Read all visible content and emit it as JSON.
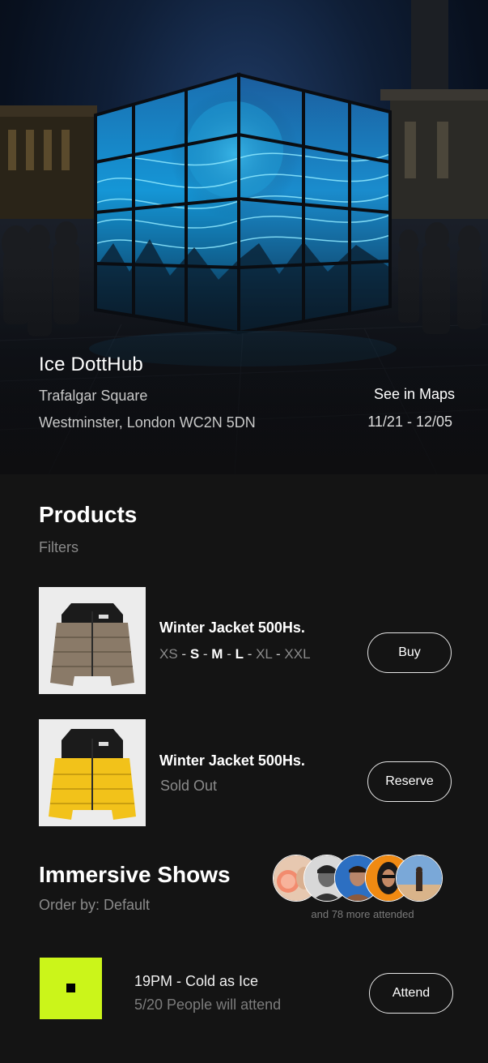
{
  "hero": {
    "title": "Ice DottHub",
    "address_line1": "Trafalgar Square",
    "address_line2": "Westminster, London WC2N 5DN",
    "maps_label": "See in Maps",
    "dates": "11/21 - 12/05"
  },
  "products": {
    "title": "Products",
    "filters_label": "Filters",
    "items": [
      {
        "name": "Winter Jacket 500Hs.",
        "sizes": [
          "XS",
          "S",
          "M",
          "L",
          "XL",
          "XXL"
        ],
        "sizes_available": [
          "S",
          "M",
          "L"
        ],
        "action_label": "Buy"
      },
      {
        "name": "Winter Jacket 500Hs.",
        "status": "Sold Out",
        "action_label": "Reserve"
      }
    ]
  },
  "shows": {
    "title": "Immersive Shows",
    "order_label": "Order by: Default",
    "attended_label": "and 78 more attended",
    "items": [
      {
        "title": "19PM  - Cold as Ice",
        "subtitle": "5/20 People will attend",
        "action_label": "Attend"
      }
    ]
  },
  "colors": {
    "background": "#141414",
    "accent": "#cbf51a",
    "muted_text": "#8a8a8a"
  }
}
